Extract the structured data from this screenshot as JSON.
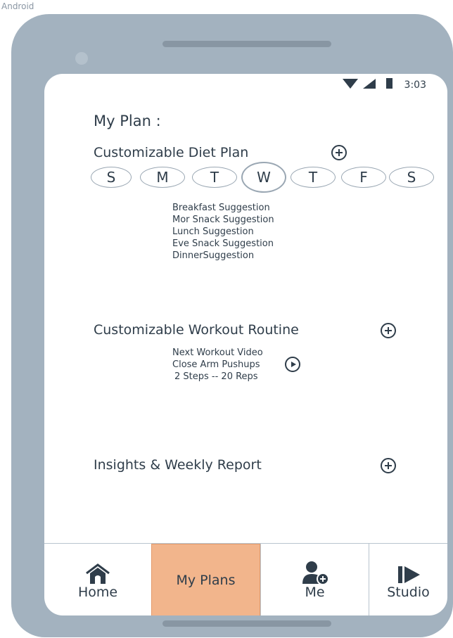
{
  "device_label": "Android",
  "status_bar": {
    "time": "3:03",
    "icons": [
      "wifi-icon",
      "signal-icon",
      "battery-icon"
    ]
  },
  "page": {
    "title": "My Plan :"
  },
  "diet_section": {
    "title": "Customizable Diet Plan",
    "days": [
      "S",
      "M",
      "T",
      "W",
      "T",
      "F",
      "S"
    ],
    "selected_day_index": 3,
    "suggestions": [
      "Breakfast Suggestion",
      "Mor Snack Suggestion",
      "Lunch Suggestion",
      "Eve Snack Suggestion",
      "DinnerSuggestion"
    ]
  },
  "workout_section": {
    "title": "Customizable Workout Routine",
    "next_label": "Next Workout Video",
    "exercise": "Close Arm Pushups",
    "detail": "2 Steps -- 20 Reps"
  },
  "insights_section": {
    "title": "Insights & Weekly Report"
  },
  "bottom_nav": {
    "items": [
      {
        "label": "Home",
        "icon": "home-icon"
      },
      {
        "label": "My Plans",
        "icon": ""
      },
      {
        "label": "Me",
        "icon": "add-user-icon"
      },
      {
        "label": "Studio",
        "icon": "fast-forward-icon"
      }
    ],
    "active_index": 1,
    "active_color": "#f2b58c"
  },
  "colors": {
    "device_frame": "#a3b2bf",
    "text": "#2f3d4a"
  }
}
